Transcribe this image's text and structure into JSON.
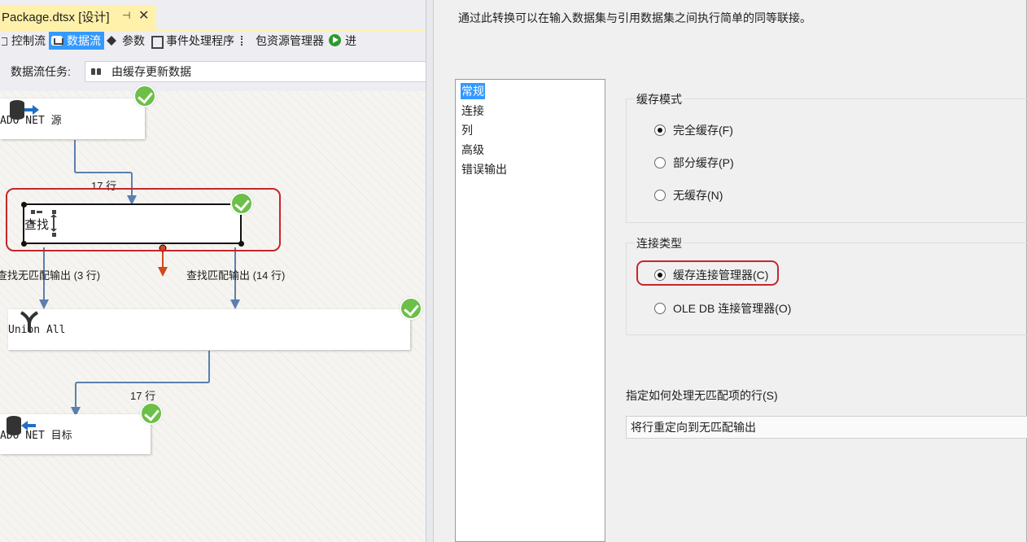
{
  "document_tab": {
    "title": "Package.dtsx [设计]",
    "pin": "⊣",
    "close": "✕"
  },
  "designer_tabs": [
    {
      "label": "控制流",
      "icon": "control-flow-icon"
    },
    {
      "label": "数据流",
      "icon": "data-flow-icon",
      "active": true
    },
    {
      "label": "参数",
      "icon": "parameters-icon"
    },
    {
      "label": "事件处理程序",
      "icon": "event-handlers-icon"
    },
    {
      "label": "包资源管理器",
      "icon": "package-explorer-icon"
    },
    {
      "label": "进",
      "icon": "run-icon"
    }
  ],
  "task_bar": {
    "label": "数据流任务:",
    "value": "由缓存更新数据"
  },
  "canvas": {
    "components": {
      "source": "ADO NET 源",
      "lookup": "查找",
      "union": "Union All",
      "destination": "ADO NET 目标"
    },
    "flows": {
      "source_to_lookup": "17 行",
      "no_match": "查找无匹配输出 (3 行)",
      "match": "查找匹配输出 (14 行)",
      "union_to_dest": "17 行"
    }
  },
  "dialog": {
    "description": "通过此转换可以在输入数据集与引用数据集之间执行简单的同等联接。",
    "nav_items": [
      "常规",
      "连接",
      "列",
      "高级",
      "错误输出"
    ],
    "cache_mode": {
      "title": "缓存模式",
      "options": [
        "完全缓存(F)",
        "部分缓存(P)",
        "无缓存(N)"
      ],
      "selected": "完全缓存(F)"
    },
    "connection_type": {
      "title": "连接类型",
      "options": [
        "缓存连接管理器(C)",
        "OLE DB 连接管理器(O)"
      ],
      "selected": "缓存连接管理器(C)"
    },
    "no_match_rows": {
      "label": "指定如何处理无匹配项的行(S)",
      "value": "将行重定向到无匹配输出"
    }
  },
  "colors": {
    "tab_active": "#fff1a9",
    "selection": "#3399ff",
    "success": "#6cbf47",
    "highlight": "#c5272c",
    "flow_path": "#5a7fb0",
    "error_path": "#d04a1e"
  }
}
